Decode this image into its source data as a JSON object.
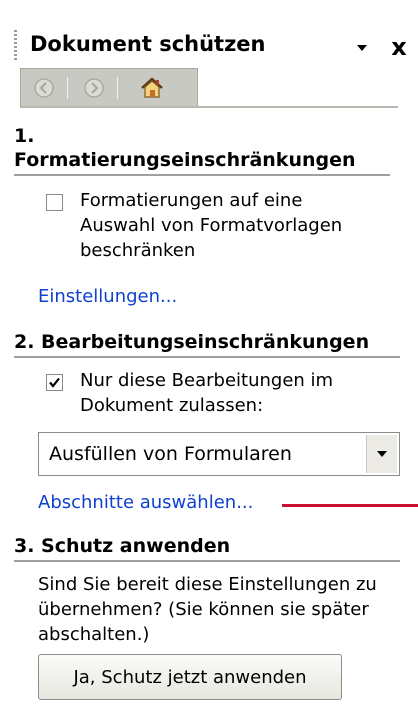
{
  "title": "Dokument schützen",
  "titlebar": {
    "dropdown_icon": "dropdown-arrow",
    "close_label": "x"
  },
  "nav": {
    "back_icon": "back-arrow",
    "forward_icon": "forward-arrow",
    "home_icon": "home"
  },
  "section1": {
    "heading_line1": "1.",
    "heading_line2": "Formatierungseinschränkungen",
    "checkbox_checked": false,
    "checkbox_label_lines": [
      "Formatierungen auf eine",
      "Auswahl von Formatvorlagen",
      "beschränken"
    ],
    "link": "Einstellungen..."
  },
  "section2": {
    "heading": "2. Bearbeitungseinschränkungen",
    "checkbox_checked": true,
    "checkbox_label_lines": [
      "Nur diese Bearbeitungen im",
      "Dokument zulassen:"
    ],
    "select_value": "Ausfüllen von Formularen",
    "link": "Abschnitte auswählen..."
  },
  "section3": {
    "heading": "3. Schutz anwenden",
    "text_lines": [
      "Sind Sie bereit diese Einstellungen zu",
      "übernehmen? (Sie können sie später",
      "abschalten.)"
    ],
    "button": "Ja, Schutz jetzt anwenden"
  },
  "colors": {
    "link": "#1040d0",
    "annotation_line": "#c8102e",
    "nav_bar": "#c9c9c3"
  }
}
